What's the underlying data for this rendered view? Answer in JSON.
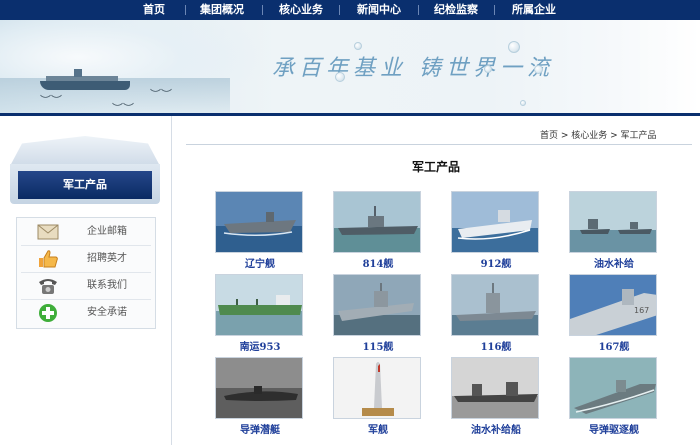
{
  "nav": {
    "items": [
      "首页",
      "集团概况",
      "核心业务",
      "新闻中心",
      "纪检监察",
      "所属企业"
    ]
  },
  "banner": {
    "slogan": "承百年基业 铸世界一流"
  },
  "sidebar": {
    "title": "军工产品",
    "links": [
      {
        "label": "企业邮箱",
        "icon": "envelope-icon"
      },
      {
        "label": "招聘英才",
        "icon": "thumbs-up-icon"
      },
      {
        "label": "联系我们",
        "icon": "telephone-icon"
      },
      {
        "label": "安全承诺",
        "icon": "safety-badge-icon"
      }
    ]
  },
  "breadcrumb": "首页 > 核心业务 > 军工产品",
  "section_title": "军工产品",
  "products": [
    {
      "name": "辽宁舰"
    },
    {
      "name": "814舰"
    },
    {
      "name": "912舰"
    },
    {
      "name": "油水补给"
    },
    {
      "name": "南运953"
    },
    {
      "name": "115舰"
    },
    {
      "name": "116舰"
    },
    {
      "name": "167舰"
    },
    {
      "name": "导弹潜艇"
    },
    {
      "name": "军舰"
    },
    {
      "name": "油水补给船"
    },
    {
      "name": "导弹驱逐舰"
    }
  ],
  "colors": {
    "nav_bg": "#0a2f6e",
    "product_label": "#1f3f9a",
    "slogan": "#6fa0c2"
  }
}
